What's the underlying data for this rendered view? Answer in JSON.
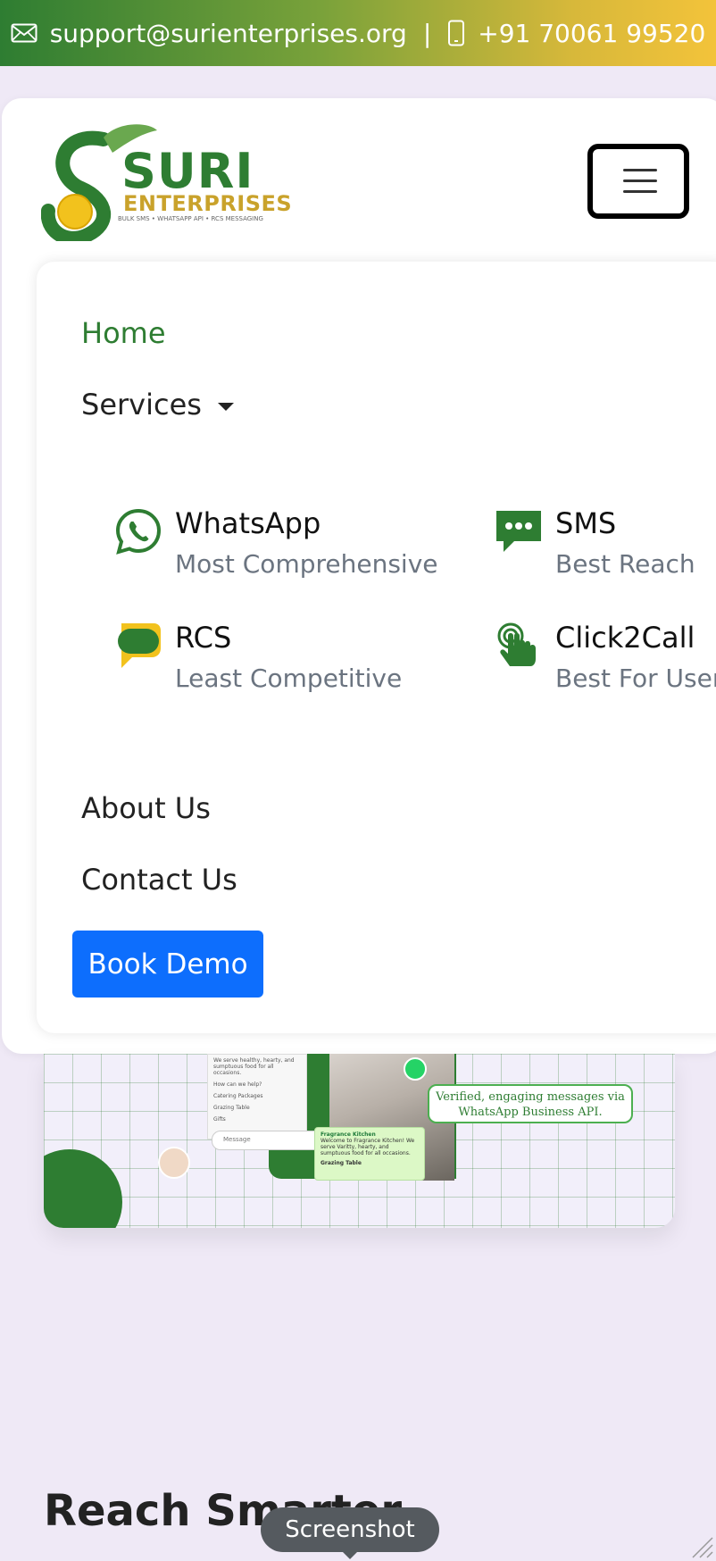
{
  "topbar": {
    "email": "support@surienterprises.org",
    "separator": "|",
    "phone": "+91 70061 99520",
    "email_icon": "envelope-icon",
    "phone_icon": "mobile-phone-icon"
  },
  "brand": {
    "name": "SURI",
    "subtitle": "ENTERPRISES",
    "tagline": "BULK SMS • WHATSAPP API • RCS MESSAGING",
    "colors": {
      "green": "#2e7d32",
      "gold": "#c9a22b"
    }
  },
  "nav": {
    "home": "Home",
    "services": "Services",
    "about": "About Us",
    "contact": "Contact Us",
    "book_demo": "Book Demo",
    "toggler_icon": "hamburger-menu-icon"
  },
  "services": [
    {
      "name": "WhatsApp",
      "desc": "Most Comprehensive",
      "icon": "whatsapp-icon"
    },
    {
      "name": "SMS",
      "desc": "Best Reach",
      "icon": "sms-chat-icon"
    },
    {
      "name": "RCS",
      "desc": "Least Competitive",
      "icon": "rcs-chat-icon"
    },
    {
      "name": "Click2Call",
      "desc": "Best For User E",
      "icon": "tap-call-icon"
    }
  ],
  "hero": {
    "verified_line1": "Verified, engaging messages via",
    "verified_line2": "WhatsApp Business API.",
    "chat_sender": "Fragrance Kitchen",
    "chat_message": "Welcome to Fragrance Kitchen! We serve Varitty, hearty, and sumptuous food for all occasions.",
    "chat_item": "Grazing Table",
    "phone_lines": [
      "We serve healthy, hearty, and sumptuous food for all occasions.",
      "How can we help?",
      "Catering Packages",
      "Grazing Table",
      "Gifts"
    ],
    "phone_input": "Message"
  },
  "section": {
    "heading": "Reach Smarter"
  },
  "overlay": {
    "screenshot_label": "Screenshot"
  }
}
